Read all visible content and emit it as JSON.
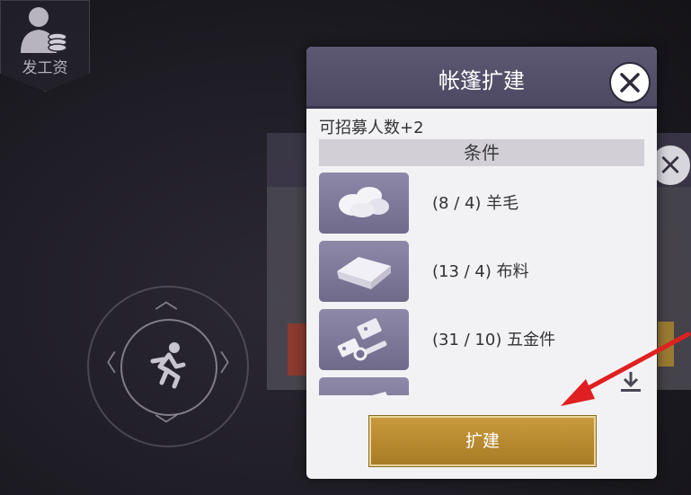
{
  "hud": {
    "pay_label": "发工资"
  },
  "dialog": {
    "title": "帐篷扩建",
    "benefit": "可招募人数+2",
    "conditions_header": "条件",
    "requirements": [
      {
        "icon": "wool-icon",
        "text": "(8 / 4) 羊毛"
      },
      {
        "icon": "cloth-icon",
        "text": "(13 / 4) 布料"
      },
      {
        "icon": "hardware-icon",
        "text": "(31 / 10) 五金件"
      },
      {
        "icon": "plank-icon",
        "text": ""
      }
    ],
    "expand_label": "扩建"
  },
  "colors": {
    "header": "#5d5873",
    "thumb": "#7f7a9a",
    "button_gold": "#b88a30",
    "arrow_red": "#e02020"
  }
}
